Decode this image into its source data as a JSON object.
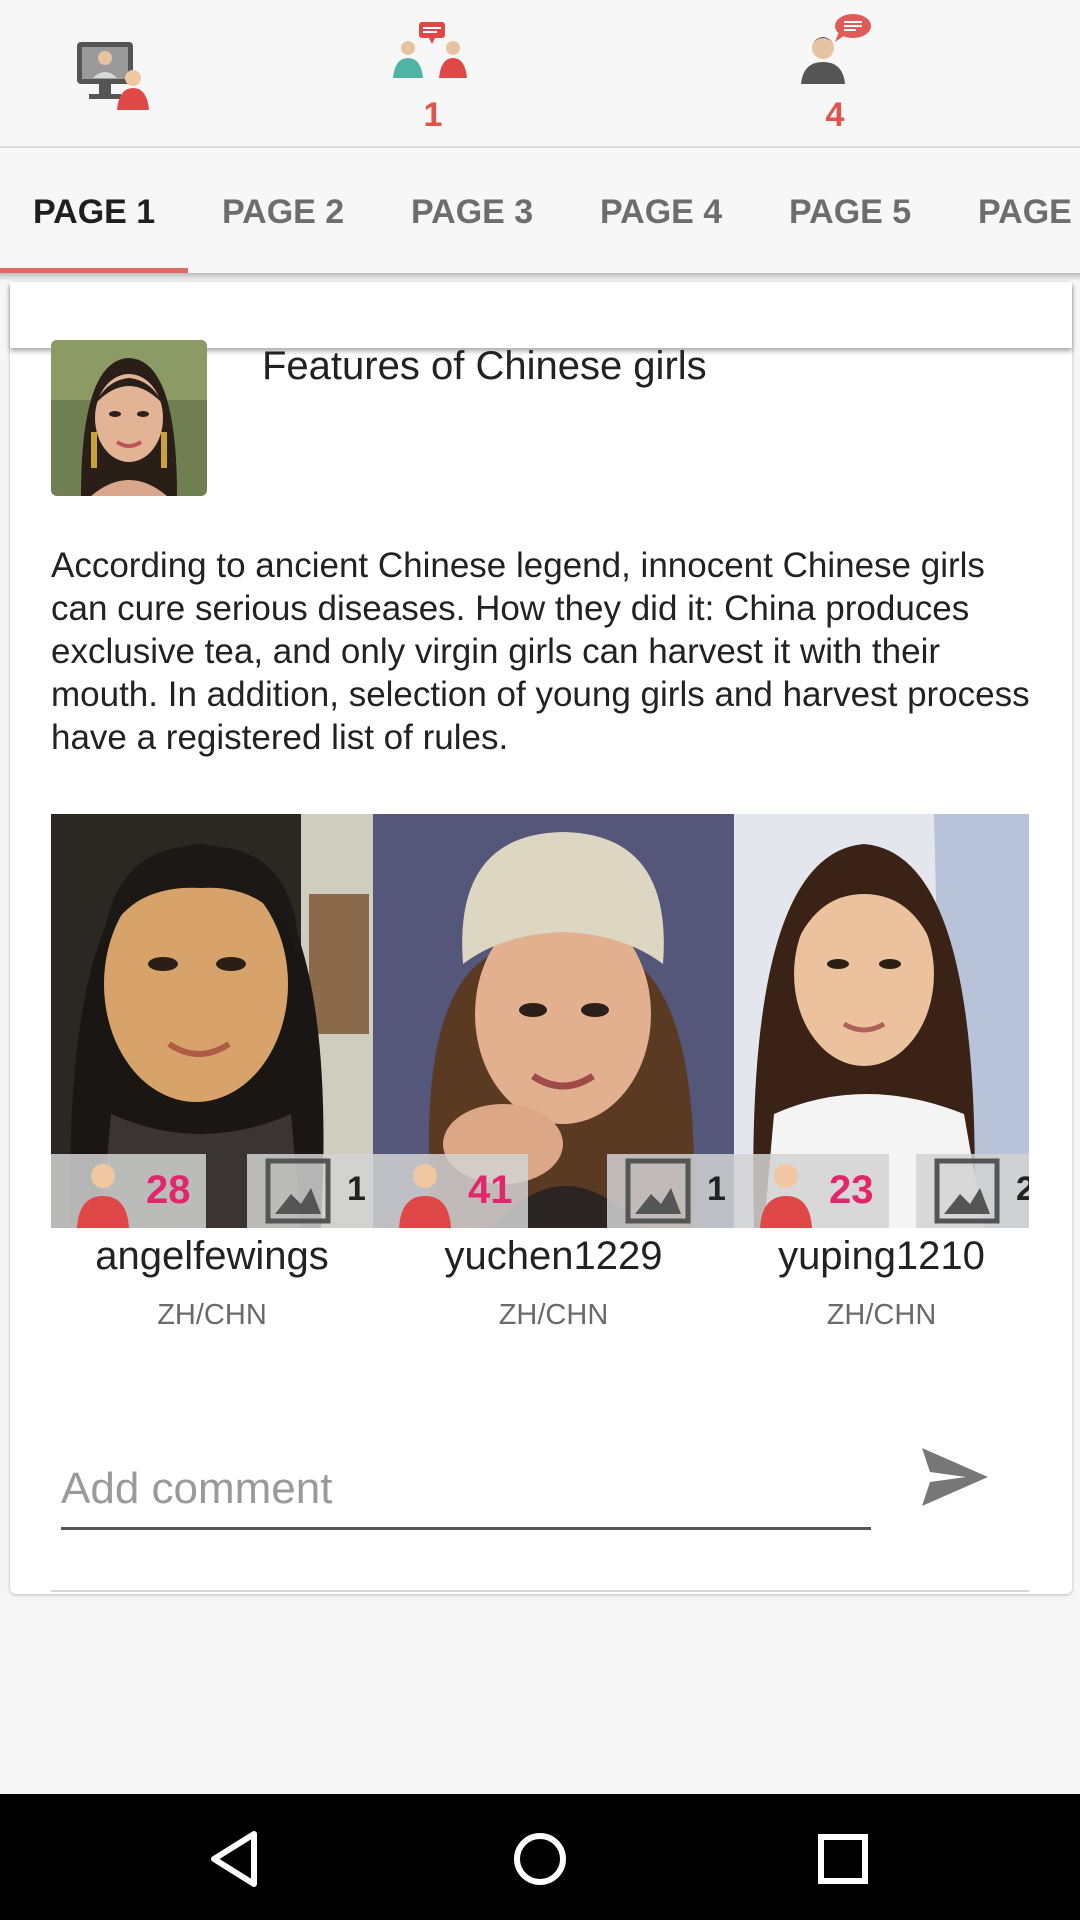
{
  "topbar": {
    "items": [
      {
        "name": "video-chat",
        "icon": "video-chat-icon",
        "count": ""
      },
      {
        "name": "chats",
        "icon": "people-chat-icon",
        "count": "1"
      },
      {
        "name": "messages",
        "icon": "person-message-icon",
        "count": "4"
      }
    ]
  },
  "tabs": [
    "PAGE 1",
    "PAGE 2",
    "PAGE 3",
    "PAGE 4",
    "PAGE 5",
    "PAGE"
  ],
  "active_tab": "PAGE 1",
  "post": {
    "title": "Features of Chinese girls",
    "body": "According to ancient Chinese legend, innocent Chinese girls can cure serious diseases. How they did it: China produces exclusive tea, and only virgin girls can harvest it with their mouth. In addition, selection of young girls and harvest process have a registered list of rules."
  },
  "profiles": [
    {
      "username": "angelfewings",
      "age": "28",
      "photos": "1",
      "country": "ZH/CHN"
    },
    {
      "username": "yuchen1229",
      "age": "41",
      "photos": "1",
      "country": "ZH/CHN"
    },
    {
      "username": "yuping1210",
      "age": "23",
      "photos": "2",
      "country": "ZH/CHN"
    }
  ],
  "comment": {
    "placeholder": "Add comment",
    "value": ""
  },
  "colors": {
    "accent": "#e06a66",
    "age": "#e3266b",
    "count": "#e0524a"
  }
}
